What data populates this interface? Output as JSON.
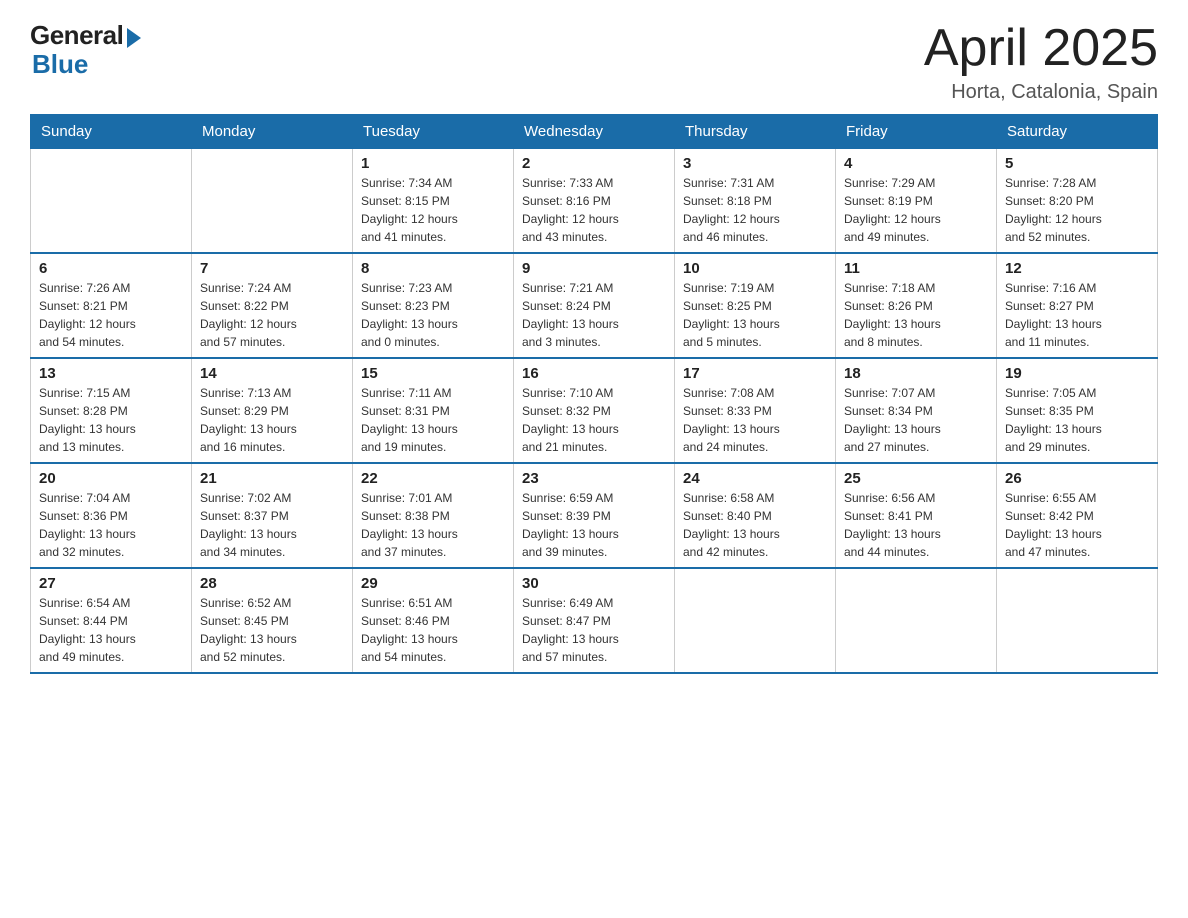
{
  "header": {
    "title": "April 2025",
    "location": "Horta, Catalonia, Spain",
    "logo_general": "General",
    "logo_blue": "Blue"
  },
  "days_of_week": [
    "Sunday",
    "Monday",
    "Tuesday",
    "Wednesday",
    "Thursday",
    "Friday",
    "Saturday"
  ],
  "weeks": [
    [
      {
        "day": "",
        "info": ""
      },
      {
        "day": "",
        "info": ""
      },
      {
        "day": "1",
        "info": "Sunrise: 7:34 AM\nSunset: 8:15 PM\nDaylight: 12 hours\nand 41 minutes."
      },
      {
        "day": "2",
        "info": "Sunrise: 7:33 AM\nSunset: 8:16 PM\nDaylight: 12 hours\nand 43 minutes."
      },
      {
        "day": "3",
        "info": "Sunrise: 7:31 AM\nSunset: 8:18 PM\nDaylight: 12 hours\nand 46 minutes."
      },
      {
        "day": "4",
        "info": "Sunrise: 7:29 AM\nSunset: 8:19 PM\nDaylight: 12 hours\nand 49 minutes."
      },
      {
        "day": "5",
        "info": "Sunrise: 7:28 AM\nSunset: 8:20 PM\nDaylight: 12 hours\nand 52 minutes."
      }
    ],
    [
      {
        "day": "6",
        "info": "Sunrise: 7:26 AM\nSunset: 8:21 PM\nDaylight: 12 hours\nand 54 minutes."
      },
      {
        "day": "7",
        "info": "Sunrise: 7:24 AM\nSunset: 8:22 PM\nDaylight: 12 hours\nand 57 minutes."
      },
      {
        "day": "8",
        "info": "Sunrise: 7:23 AM\nSunset: 8:23 PM\nDaylight: 13 hours\nand 0 minutes."
      },
      {
        "day": "9",
        "info": "Sunrise: 7:21 AM\nSunset: 8:24 PM\nDaylight: 13 hours\nand 3 minutes."
      },
      {
        "day": "10",
        "info": "Sunrise: 7:19 AM\nSunset: 8:25 PM\nDaylight: 13 hours\nand 5 minutes."
      },
      {
        "day": "11",
        "info": "Sunrise: 7:18 AM\nSunset: 8:26 PM\nDaylight: 13 hours\nand 8 minutes."
      },
      {
        "day": "12",
        "info": "Sunrise: 7:16 AM\nSunset: 8:27 PM\nDaylight: 13 hours\nand 11 minutes."
      }
    ],
    [
      {
        "day": "13",
        "info": "Sunrise: 7:15 AM\nSunset: 8:28 PM\nDaylight: 13 hours\nand 13 minutes."
      },
      {
        "day": "14",
        "info": "Sunrise: 7:13 AM\nSunset: 8:29 PM\nDaylight: 13 hours\nand 16 minutes."
      },
      {
        "day": "15",
        "info": "Sunrise: 7:11 AM\nSunset: 8:31 PM\nDaylight: 13 hours\nand 19 minutes."
      },
      {
        "day": "16",
        "info": "Sunrise: 7:10 AM\nSunset: 8:32 PM\nDaylight: 13 hours\nand 21 minutes."
      },
      {
        "day": "17",
        "info": "Sunrise: 7:08 AM\nSunset: 8:33 PM\nDaylight: 13 hours\nand 24 minutes."
      },
      {
        "day": "18",
        "info": "Sunrise: 7:07 AM\nSunset: 8:34 PM\nDaylight: 13 hours\nand 27 minutes."
      },
      {
        "day": "19",
        "info": "Sunrise: 7:05 AM\nSunset: 8:35 PM\nDaylight: 13 hours\nand 29 minutes."
      }
    ],
    [
      {
        "day": "20",
        "info": "Sunrise: 7:04 AM\nSunset: 8:36 PM\nDaylight: 13 hours\nand 32 minutes."
      },
      {
        "day": "21",
        "info": "Sunrise: 7:02 AM\nSunset: 8:37 PM\nDaylight: 13 hours\nand 34 minutes."
      },
      {
        "day": "22",
        "info": "Sunrise: 7:01 AM\nSunset: 8:38 PM\nDaylight: 13 hours\nand 37 minutes."
      },
      {
        "day": "23",
        "info": "Sunrise: 6:59 AM\nSunset: 8:39 PM\nDaylight: 13 hours\nand 39 minutes."
      },
      {
        "day": "24",
        "info": "Sunrise: 6:58 AM\nSunset: 8:40 PM\nDaylight: 13 hours\nand 42 minutes."
      },
      {
        "day": "25",
        "info": "Sunrise: 6:56 AM\nSunset: 8:41 PM\nDaylight: 13 hours\nand 44 minutes."
      },
      {
        "day": "26",
        "info": "Sunrise: 6:55 AM\nSunset: 8:42 PM\nDaylight: 13 hours\nand 47 minutes."
      }
    ],
    [
      {
        "day": "27",
        "info": "Sunrise: 6:54 AM\nSunset: 8:44 PM\nDaylight: 13 hours\nand 49 minutes."
      },
      {
        "day": "28",
        "info": "Sunrise: 6:52 AM\nSunset: 8:45 PM\nDaylight: 13 hours\nand 52 minutes."
      },
      {
        "day": "29",
        "info": "Sunrise: 6:51 AM\nSunset: 8:46 PM\nDaylight: 13 hours\nand 54 minutes."
      },
      {
        "day": "30",
        "info": "Sunrise: 6:49 AM\nSunset: 8:47 PM\nDaylight: 13 hours\nand 57 minutes."
      },
      {
        "day": "",
        "info": ""
      },
      {
        "day": "",
        "info": ""
      },
      {
        "day": "",
        "info": ""
      }
    ]
  ]
}
